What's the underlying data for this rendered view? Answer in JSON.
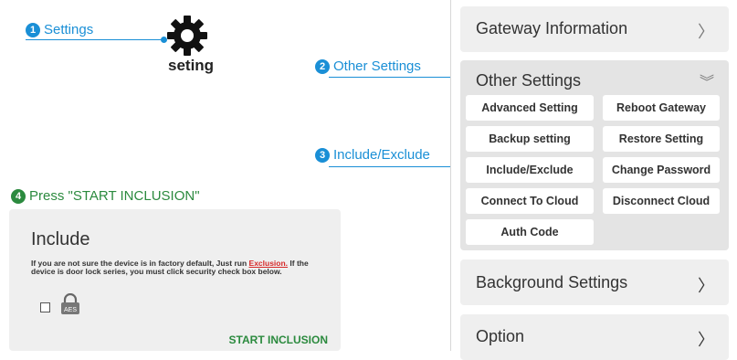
{
  "callouts": [
    {
      "number": "1",
      "label": "Settings"
    },
    {
      "number": "2",
      "label": "Other Settings"
    },
    {
      "number": "3",
      "label": "Include/Exclude"
    },
    {
      "number": "4",
      "label": "Press \"START INCLUSION\""
    }
  ],
  "gear": {
    "label": "seting",
    "icon": "gear-icon"
  },
  "panel": {
    "gateway_info": {
      "title": "Gateway Information",
      "chevron": "〉"
    },
    "other_settings": {
      "title": "Other Settings",
      "chevron": "︾",
      "buttons": [
        "Advanced Setting",
        "Reboot Gateway",
        "Backup setting",
        "Restore Setting",
        "Include/Exclude",
        "Change Password",
        "Connect To Cloud",
        "Disconnect Cloud",
        "Auth Code"
      ]
    },
    "background_settings": {
      "title": "Background Settings",
      "chevron": "〉"
    },
    "option": {
      "title": "Option",
      "chevron": "〉"
    }
  },
  "include_card": {
    "title": "Include",
    "text_part1": "If you are not sure the device is in factory default, Just run ",
    "link": "Exclusion.",
    "text_part2": " If the device is door lock series, you must click security check box below.",
    "lock_label": "AES",
    "start_button": "START INCLUSION"
  },
  "colors": {
    "accent": "#1a8fd6",
    "green": "#2b8a3e",
    "link_red": "#d62828"
  }
}
